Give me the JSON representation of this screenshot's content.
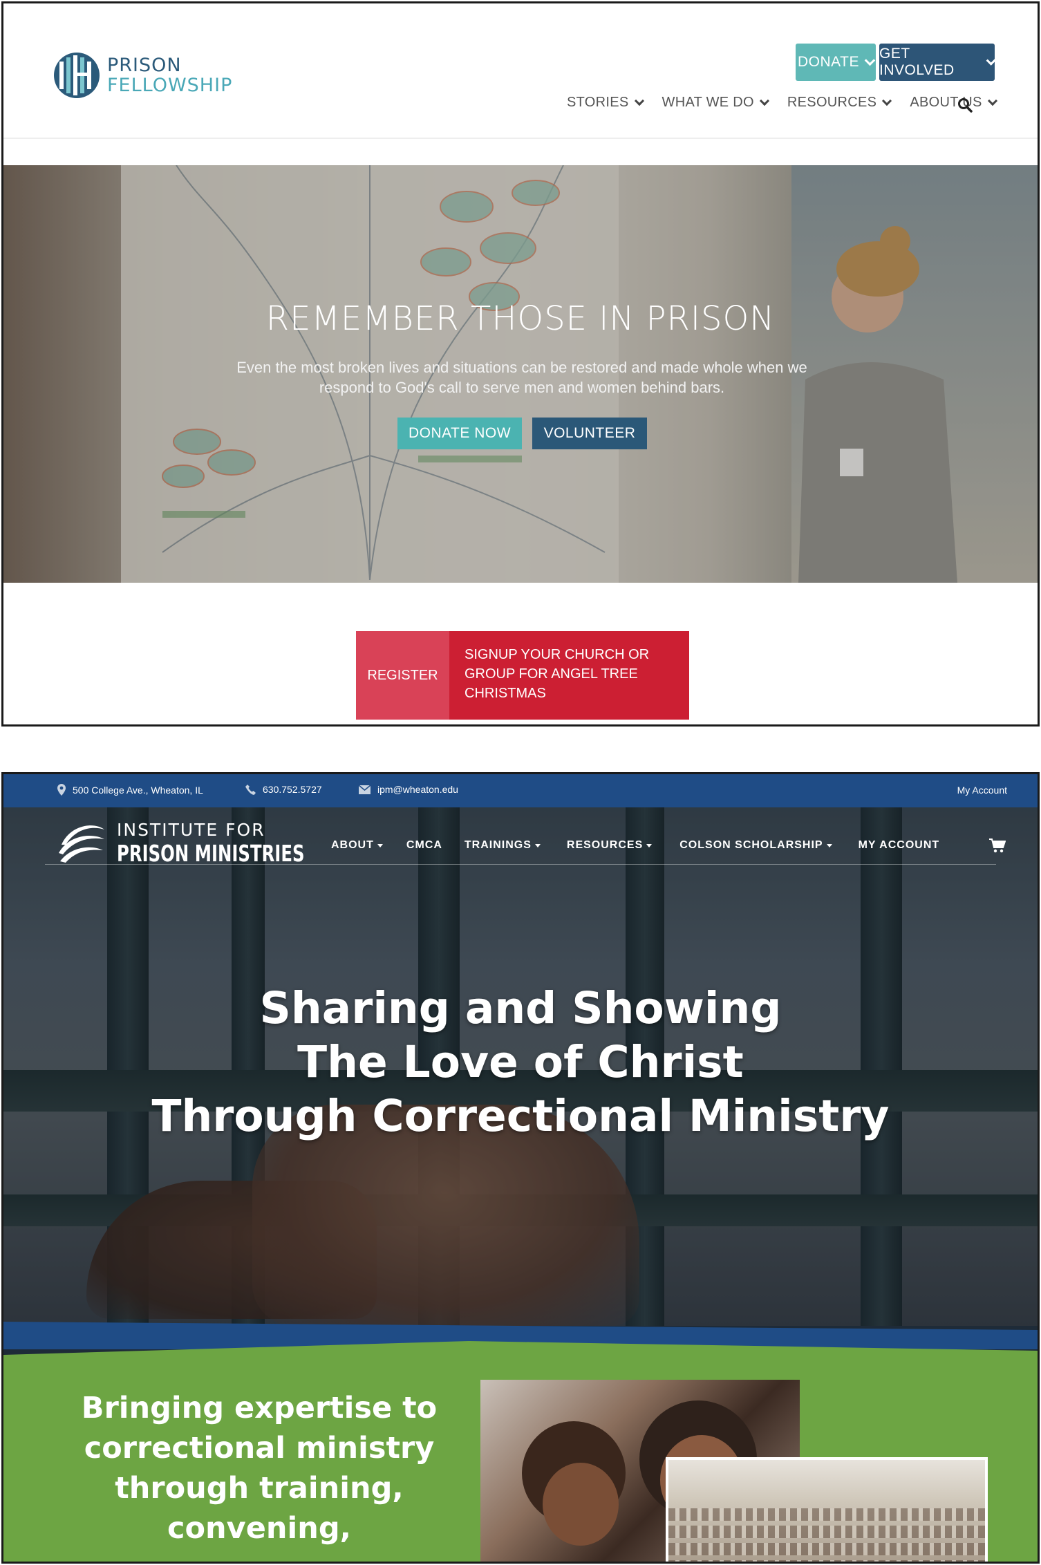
{
  "prison_fellowship": {
    "logo": {
      "line1": "PRISON",
      "line2": "FELLOWSHIP"
    },
    "header_buttons": {
      "donate": "DONATE",
      "get_involved": "GET INVOLVED"
    },
    "nav": [
      "STORIES",
      "WHAT WE DO",
      "RESOURCES",
      "ABOUT US"
    ],
    "hero": {
      "title": "REMEMBER THOSE IN PRISON",
      "subtitle": "Even the most broken lives and situations can be restored and made whole when we respond to God's call to serve men and women behind bars.",
      "donate_now": "DONATE NOW",
      "volunteer": "VOLUNTEER"
    },
    "register": {
      "label": "REGISTER",
      "text": "SIGNUP YOUR CHURCH OR GROUP FOR ANGEL TREE CHRISTMAS"
    },
    "colors": {
      "teal": "#5fb8b6",
      "navy": "#2d5577",
      "red": "#cc1f33",
      "pink": "#d94257"
    }
  },
  "ipm": {
    "topbar": {
      "address": "500 College Ave., Wheaton, IL",
      "phone": "630.752.5727",
      "email": "ipm@wheaton.edu",
      "account": "My Account"
    },
    "logo": {
      "line1": "INSTITUTE FOR",
      "line2": "PRISON MINISTRIES"
    },
    "nav": [
      {
        "label": "ABOUT",
        "dropdown": true
      },
      {
        "label": "CMCA",
        "dropdown": false
      },
      {
        "label": "TRAININGS",
        "dropdown": true
      },
      {
        "label": "RESOURCES",
        "dropdown": true
      },
      {
        "label": "COLSON SCHOLARSHIP",
        "dropdown": true
      },
      {
        "label": "MY ACCOUNT",
        "dropdown": false
      }
    ],
    "headline": [
      "Sharing and Showing",
      "The Love of Christ",
      "Through Correctional Ministry"
    ],
    "tagline": [
      "Bringing expertise to",
      "correctional ministry",
      "through training,",
      "convening,"
    ],
    "colors": {
      "blue": "#1f4c86",
      "green": "#6da543"
    }
  }
}
